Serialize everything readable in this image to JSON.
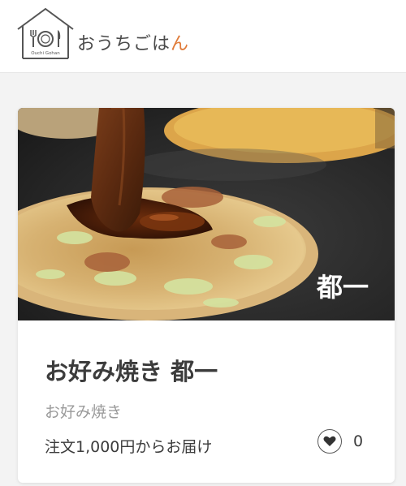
{
  "header": {
    "brand_main": "おうちごは",
    "brand_accent": "ん",
    "logo_caption": "Ouchi Gohan"
  },
  "card": {
    "image_caption": "都一",
    "shop_name": "お好み焼き 都一",
    "category": "お好み焼き",
    "delivery": "注文1,000円からお届け",
    "like_count": "0"
  },
  "colors": {
    "accent": "#e07b39",
    "background": "#f3f3f3",
    "card": "#ffffff",
    "text": "#3c3c3c",
    "muted": "#9a9a9a"
  },
  "icons": [
    "house-logo-icon",
    "fork-icon",
    "plate-icon",
    "knife-icon",
    "heart-icon"
  ]
}
